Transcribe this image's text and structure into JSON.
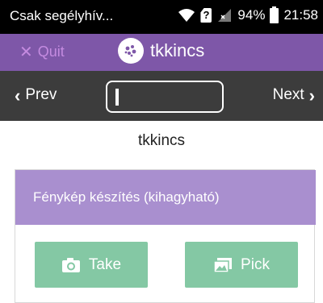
{
  "status_bar": {
    "carrier": "Csak segélyhív...",
    "battery": "94%",
    "time": "21:58"
  },
  "header": {
    "quit_label": "Quit",
    "app_title": "tkkincs"
  },
  "nav": {
    "prev_label": "Prev",
    "next_label": "Next",
    "input_value": ""
  },
  "main": {
    "page_title": "tkkincs",
    "card": {
      "title": "Fénykép készítés (kihagyható)",
      "take_label": "Take",
      "pick_label": "Pick"
    }
  },
  "colors": {
    "header_purple": "#7e57a8",
    "card_header_purple": "#a98fcf",
    "nav_dark": "#3c3c3c",
    "button_green": "#84c8a4"
  }
}
